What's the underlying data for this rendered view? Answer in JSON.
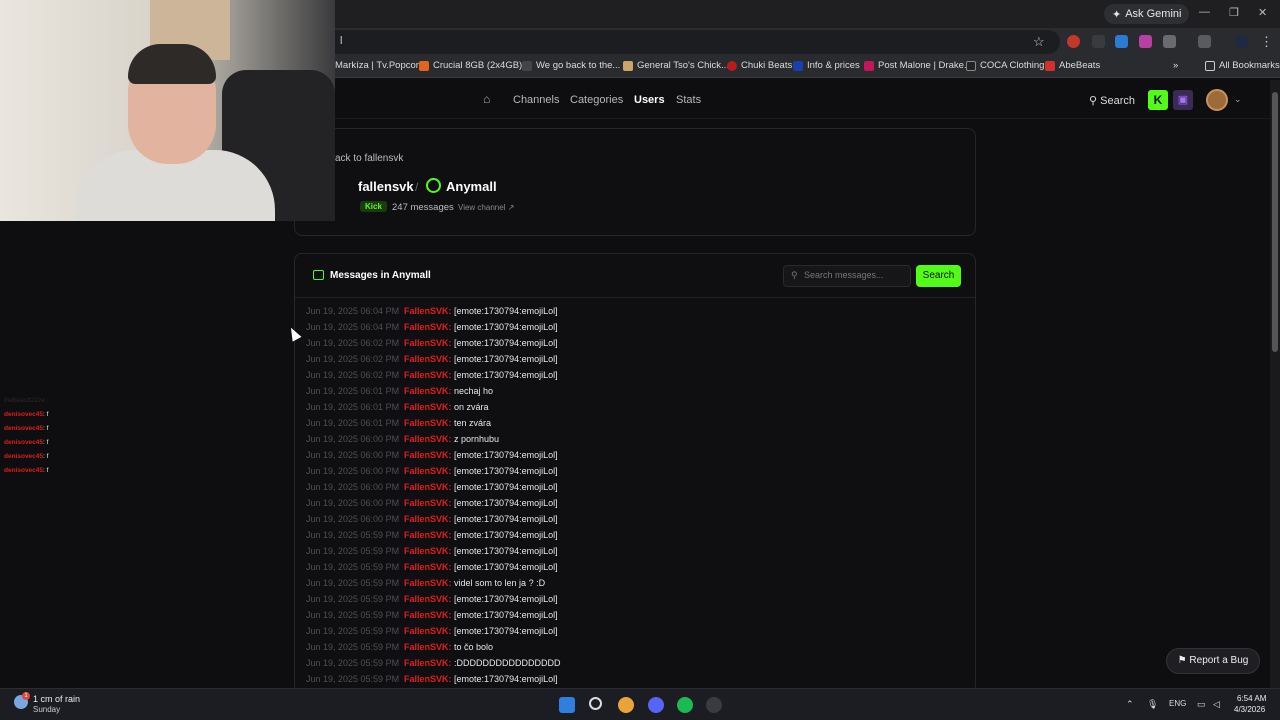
{
  "browser": {
    "ask_gemini": "Ask Gemini",
    "address": "l",
    "bookmarks": [
      "Markíza | Tv.Popcor...",
      "Crucial 8GB (2x4GB)...",
      "We go back to the...",
      "General Tso's Chick...",
      "Chuki Beats",
      "Info & prices",
      "Post Malone | Drake...",
      "COCA Clothing",
      "AbeBeats"
    ],
    "bookmarks_more": "»",
    "all_bookmarks": "All Bookmarks"
  },
  "header": {
    "nav": [
      "Channels",
      "Categories",
      "Users",
      "Stats"
    ],
    "active_nav": "Users",
    "search_label": "Search"
  },
  "profile": {
    "back_link": "ack to fallensvk",
    "channel_name": "fallensvk",
    "separator": "/",
    "user_name": "Anymall",
    "platform_badge": "Kick",
    "message_count": "247 messages",
    "view_channel": "View channel"
  },
  "messages": {
    "title": "Messages in Anymall",
    "search_placeholder": "Search messages...",
    "search_button": "Search",
    "rows": [
      {
        "ts": "Jun 19, 2025 06:04 PM",
        "user": "FallenSVK:",
        "text": "[emote:1730794:emojiLol]"
      },
      {
        "ts": "Jun 19, 2025 06:04 PM",
        "user": "FallenSVK:",
        "text": "[emote:1730794:emojiLol]"
      },
      {
        "ts": "Jun 19, 2025 06:02 PM",
        "user": "FallenSVK:",
        "text": "[emote:1730794:emojiLol]"
      },
      {
        "ts": "Jun 19, 2025 06:02 PM",
        "user": "FallenSVK:",
        "text": "[emote:1730794:emojiLol]"
      },
      {
        "ts": "Jun 19, 2025 06:02 PM",
        "user": "FallenSVK:",
        "text": "[emote:1730794:emojiLol]"
      },
      {
        "ts": "Jun 19, 2025 06:01 PM",
        "user": "FallenSVK:",
        "text": "nechaj ho"
      },
      {
        "ts": "Jun 19, 2025 06:01 PM",
        "user": "FallenSVK:",
        "text": "on zvára"
      },
      {
        "ts": "Jun 19, 2025 06:01 PM",
        "user": "FallenSVK:",
        "text": "ten zvára"
      },
      {
        "ts": "Jun 19, 2025 06:00 PM",
        "user": "FallenSVK:",
        "text": "z pornhubu"
      },
      {
        "ts": "Jun 19, 2025 06:00 PM",
        "user": "FallenSVK:",
        "text": "[emote:1730794:emojiLol]"
      },
      {
        "ts": "Jun 19, 2025 06:00 PM",
        "user": "FallenSVK:",
        "text": "[emote:1730794:emojiLol]"
      },
      {
        "ts": "Jun 19, 2025 06:00 PM",
        "user": "FallenSVK:",
        "text": "[emote:1730794:emojiLol]"
      },
      {
        "ts": "Jun 19, 2025 06:00 PM",
        "user": "FallenSVK:",
        "text": "[emote:1730794:emojiLol]"
      },
      {
        "ts": "Jun 19, 2025 06:00 PM",
        "user": "FallenSVK:",
        "text": "[emote:1730794:emojiLol]"
      },
      {
        "ts": "Jun 19, 2025 05:59 PM",
        "user": "FallenSVK:",
        "text": "[emote:1730794:emojiLol]"
      },
      {
        "ts": "Jun 19, 2025 05:59 PM",
        "user": "FallenSVK:",
        "text": "[emote:1730794:emojiLol]"
      },
      {
        "ts": "Jun 19, 2025 05:59 PM",
        "user": "FallenSVK:",
        "text": "[emote:1730794:emojiLol]"
      },
      {
        "ts": "Jun 19, 2025 05:59 PM",
        "user": "FallenSVK:",
        "text": "videl som to len ja ? :D"
      },
      {
        "ts": "Jun 19, 2025 05:59 PM",
        "user": "FallenSVK:",
        "text": "[emote:1730794:emojiLol]"
      },
      {
        "ts": "Jun 19, 2025 05:59 PM",
        "user": "FallenSVK:",
        "text": "[emote:1730794:emojiLol]"
      },
      {
        "ts": "Jun 19, 2025 05:59 PM",
        "user": "FallenSVK:",
        "text": "[emote:1730794:emojiLol]"
      },
      {
        "ts": "Jun 19, 2025 05:59 PM",
        "user": "FallenSVK:",
        "text": "to čo bolo"
      },
      {
        "ts": "Jun 19, 2025 05:59 PM",
        "user": "FallenSVK:",
        "text": ":DDDDDDDDDDDDDDDD"
      },
      {
        "ts": "Jun 19, 2025 05:59 PM",
        "user": "FallenSVK:",
        "text": "[emote:1730794:emojiLol]"
      }
    ]
  },
  "overlay_chat": [
    {
      "user": "denisovec45",
      "text": ": f"
    },
    {
      "user": "denisovec45",
      "text": ": f"
    },
    {
      "user": "denisovec45",
      "text": ": f"
    },
    {
      "user": "denisovec45",
      "text": ": f"
    },
    {
      "user": "denisovec45",
      "text": ": f"
    }
  ],
  "overlay_chat_faded": "thebeastt22ze :",
  "report_bug": "Report a Bug",
  "taskbar": {
    "weather_line1": "1 cm of rain",
    "weather_line2": "Sunday",
    "weather_badge": "1",
    "language": "ENG",
    "time": "6:54 AM",
    "date": "4/3/2026"
  },
  "colors": {
    "accent": "#53fc18",
    "username": "#e11d1d",
    "background": "#0e0e10"
  }
}
